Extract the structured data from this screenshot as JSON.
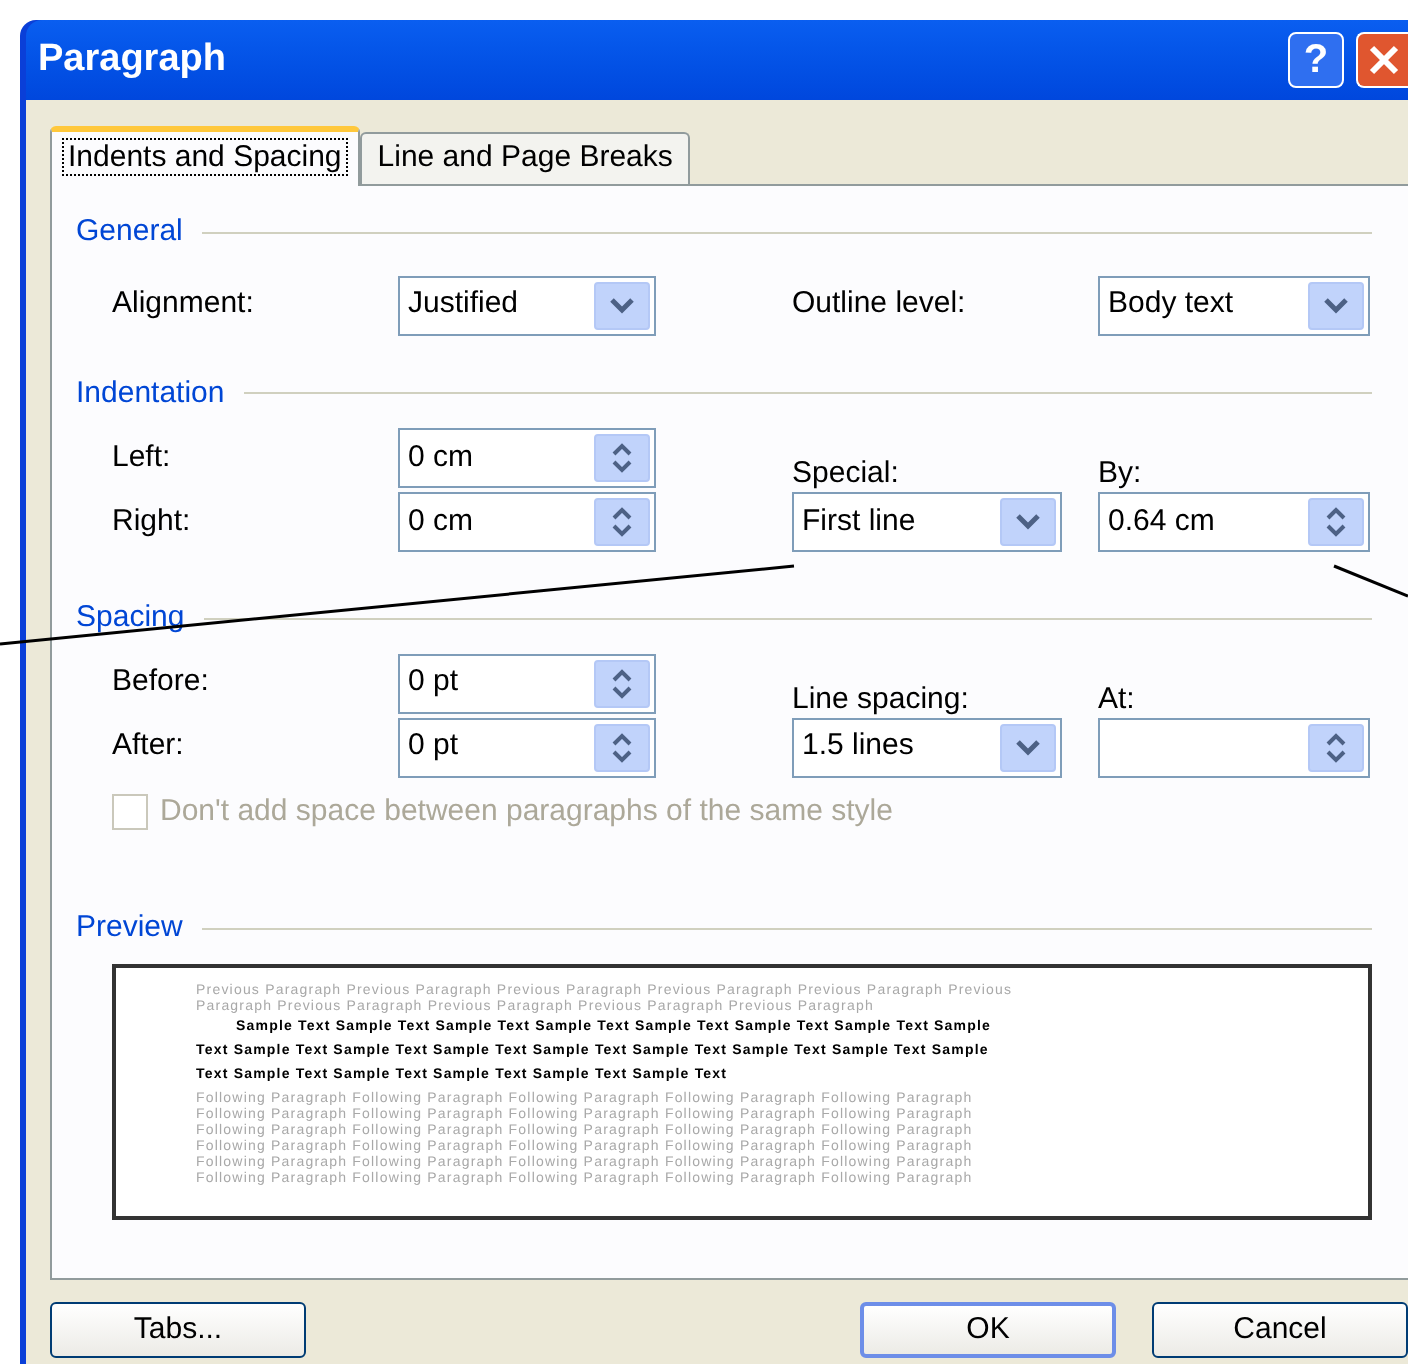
{
  "window": {
    "title": "Paragraph",
    "help_label": "?"
  },
  "tabs": [
    {
      "label": "Indents and Spacing",
      "selected": true
    },
    {
      "label": "Line and Page Breaks",
      "selected": false
    }
  ],
  "general": {
    "heading": "General",
    "alignment": {
      "label": "Alignment:",
      "value": "Justified",
      "kind": "dropdown"
    },
    "outline_level": {
      "label": "Outline level:",
      "value": "Body text",
      "kind": "dropdown"
    }
  },
  "indentation": {
    "heading": "Indentation",
    "left": {
      "label": "Left:",
      "value": "0 cm",
      "kind": "spin"
    },
    "right": {
      "label": "Right:",
      "value": "0 cm",
      "kind": "spin"
    },
    "special": {
      "label": "Special:",
      "value": "First line",
      "kind": "dropdown"
    },
    "by": {
      "label": "By:",
      "value": "0.64 cm",
      "kind": "spin"
    }
  },
  "spacing": {
    "heading": "Spacing",
    "before": {
      "label": "Before:",
      "value": "0 pt",
      "kind": "spin"
    },
    "after": {
      "label": "After:",
      "value": "0 pt",
      "kind": "spin"
    },
    "line_spacing": {
      "label": "Line spacing:",
      "value": "1.5 lines",
      "kind": "dropdown"
    },
    "at": {
      "label": "At:",
      "kind": "spin"
    },
    "no_space_option": {
      "label": "Don't add space between paragraphs of the same style",
      "checked": false,
      "disabled": true
    }
  },
  "preview": {
    "heading": "Preview",
    "previous_lines": [
      "Previous Paragraph Previous Paragraph Previous Paragraph Previous Paragraph Previous Paragraph Previous",
      "Paragraph Previous Paragraph Previous Paragraph Previous Paragraph Previous Paragraph"
    ],
    "sample_lines": [
      "Sample Text Sample Text Sample Text Sample Text Sample Text Sample Text Sample Text Sample",
      "Text Sample Text Sample Text Sample Text Sample Text Sample Text Sample Text Sample Text Sample",
      "Text Sample Text Sample Text Sample Text Sample Text Sample Text"
    ],
    "following_lines": [
      "Following Paragraph Following Paragraph Following Paragraph Following Paragraph Following Paragraph",
      "Following Paragraph Following Paragraph Following Paragraph Following Paragraph Following Paragraph",
      "Following Paragraph Following Paragraph Following Paragraph Following Paragraph Following Paragraph",
      "Following Paragraph Following Paragraph Following Paragraph Following Paragraph Following Paragraph",
      "Following Paragraph Following Paragraph Following Paragraph Following Paragraph Following Paragraph",
      "Following Paragraph Following Paragraph Following Paragraph Following Paragraph Following Paragraph"
    ]
  },
  "buttons": [
    {
      "label": "Tabs...",
      "default": false
    },
    {
      "label": "OK",
      "default": true
    },
    {
      "label": "Cancel",
      "default": false
    }
  ]
}
